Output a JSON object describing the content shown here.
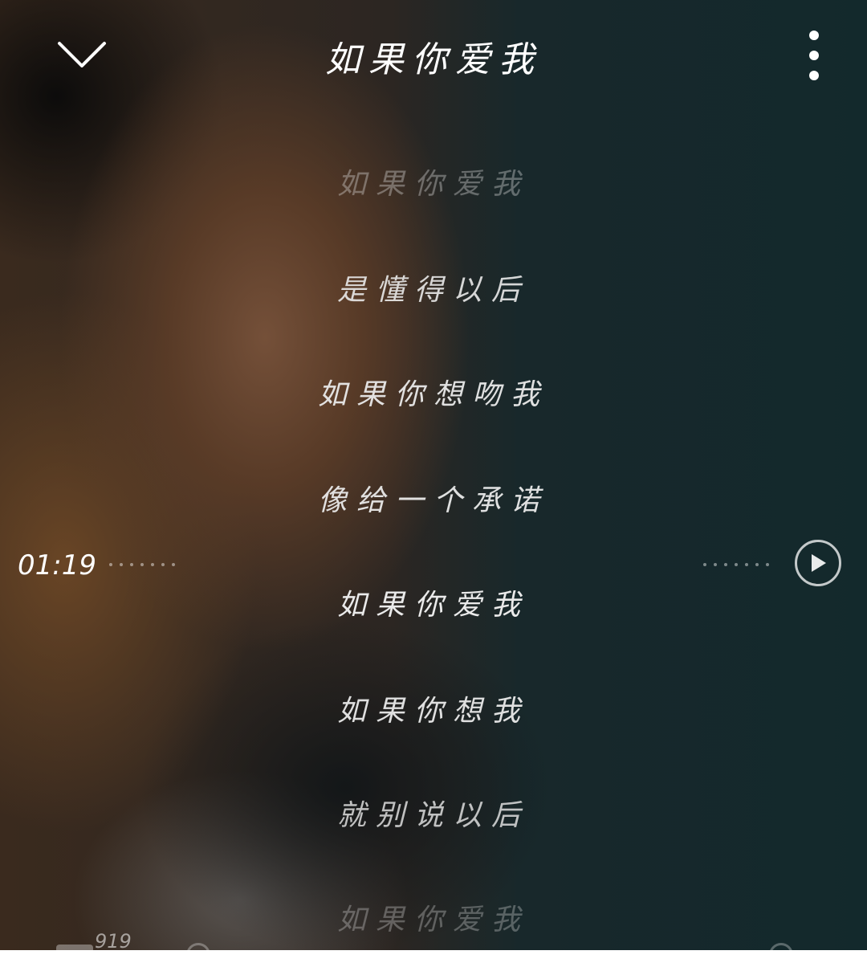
{
  "header": {
    "title": "如果你爱我",
    "collapse_icon": "chevron-down-icon",
    "more_icon": "more-vertical-icon"
  },
  "lyrics": {
    "lines": [
      {
        "text": "如果你爱我",
        "opacity": 0.35
      },
      {
        "text": "是懂得以后",
        "opacity": 0.9
      },
      {
        "text": "如果你想吻我",
        "opacity": 0.95
      },
      {
        "text": "像给一个承诺",
        "opacity": 0.95
      },
      {
        "text": "如果你爱我",
        "opacity": 1.0
      },
      {
        "text": "如果你想我",
        "opacity": 0.95
      },
      {
        "text": "就别说以后",
        "opacity": 0.8
      },
      {
        "text": "如果你爱我",
        "opacity": 0.3
      }
    ]
  },
  "seek": {
    "time": "01:19",
    "play_icon": "play-icon"
  },
  "bottom": {
    "count": "919"
  }
}
